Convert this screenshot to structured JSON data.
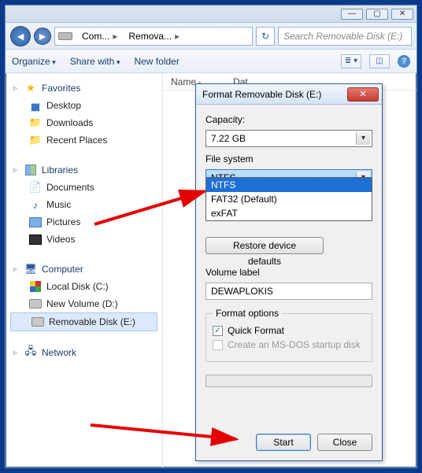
{
  "window": {
    "breadcrumbs": {
      "seg1": "Com...",
      "seg2": "Remova..."
    },
    "search_placeholder": "Search Removable Disk (E:)"
  },
  "toolbar": {
    "organize": "Organize",
    "share": "Share with",
    "newfolder": "New folder"
  },
  "columns": {
    "name": "Name",
    "date": "Dat"
  },
  "sidebar": {
    "favorites": {
      "label": "Favorites",
      "items": [
        "Desktop",
        "Downloads",
        "Recent Places"
      ]
    },
    "libraries": {
      "label": "Libraries",
      "items": [
        "Documents",
        "Music",
        "Pictures",
        "Videos"
      ]
    },
    "computer": {
      "label": "Computer",
      "items": [
        "Local Disk (C:)",
        "New Volume (D:)",
        "Removable Disk (E:)"
      ]
    },
    "network": {
      "label": "Network"
    }
  },
  "dialog": {
    "title": "Format Removable Disk (E:)",
    "capacity_label": "Capacity:",
    "capacity_value": "7.22 GB",
    "fs_label": "File system",
    "fs_value": "NTFS",
    "fs_options": [
      "NTFS",
      "FAT32 (Default)",
      "exFAT"
    ],
    "restore_btn": "Restore device defaults",
    "vol_label": "Volume label",
    "vol_value": "DEWAPLOKIS",
    "opts_label": "Format options",
    "quick_format": "Quick Format",
    "msdos": "Create an MS-DOS startup disk",
    "start_btn": "Start",
    "close_btn": "Close"
  }
}
